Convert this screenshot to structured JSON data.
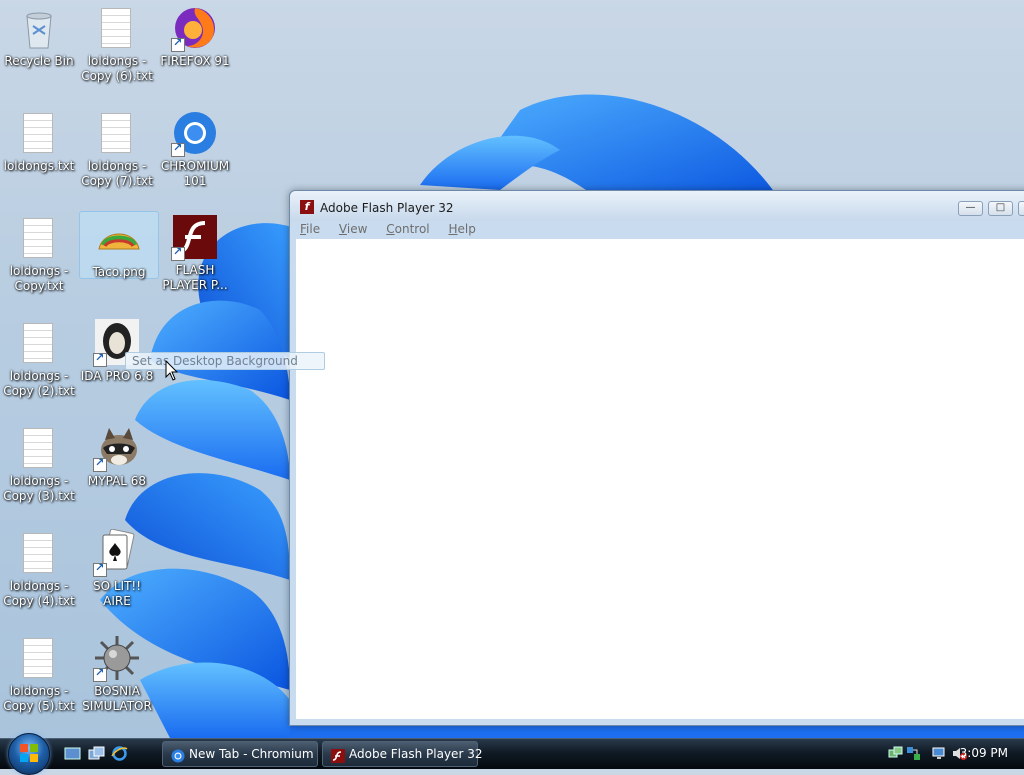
{
  "desktop": {
    "icons": [
      {
        "label": "Recycle Bin"
      },
      {
        "label": "loldongs - Copy (6).txt"
      },
      {
        "label": "FIREFOX 91"
      },
      {
        "label": "loldongs.txt"
      },
      {
        "label": "loldongs - Copy (7).txt"
      },
      {
        "label": "CHROMIUM 101"
      },
      {
        "label": "loldongs - Copy.txt"
      },
      {
        "label": "Taco.png"
      },
      {
        "label": "FLASH PLAYER P..."
      },
      {
        "label": "loldongs - Copy (2).txt"
      },
      {
        "label": "IDA PRO 6.8"
      },
      {
        "label": "loldongs - Copy (3).txt"
      },
      {
        "label": "MYPAL 68"
      },
      {
        "label": "loldongs - Copy (4).txt"
      },
      {
        "label": "SO LIT!! AIRE"
      },
      {
        "label": "loldongs - Copy (5).txt"
      },
      {
        "label": "BOSNIA SIMULATOR"
      }
    ]
  },
  "drag_tooltip": "Set as Desktop Background",
  "flash_window": {
    "title": "Adobe Flash Player 32",
    "menu": [
      "File",
      "View",
      "Control",
      "Help"
    ]
  },
  "taskbar": {
    "buttons": [
      {
        "label": "New Tab - Chromium"
      },
      {
        "label": "Adobe Flash Player 32"
      }
    ],
    "clock": "3:09 PM"
  }
}
